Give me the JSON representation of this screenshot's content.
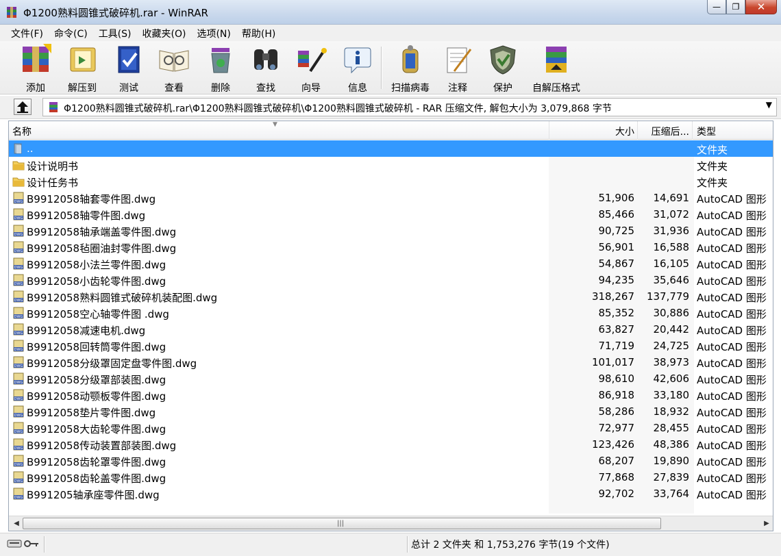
{
  "window": {
    "title": "Φ1200熟料圆锥式破碎机.rar - WinRAR",
    "buttons": {
      "minimize": "—",
      "maximize": "❐",
      "close": "✕"
    }
  },
  "menu": [
    "文件(F)",
    "命令(C)",
    "工具(S)",
    "收藏夹(O)",
    "选项(N)",
    "帮助(H)"
  ],
  "toolbar": {
    "add": "添加",
    "extract": "解压到",
    "test": "测试",
    "view": "查看",
    "delete": "删除",
    "find": "查找",
    "wizard": "向导",
    "info": "信息",
    "scan": "扫描病毒",
    "comment": "注释",
    "protect": "保护",
    "sfx": "自解压格式"
  },
  "address": {
    "path": "Φ1200熟料圆锥式破碎机.rar\\Φ1200熟料圆锥式破碎机\\Φ1200熟料圆锥式破碎机 - RAR 压缩文件, 解包大小为 3,079,868 字节"
  },
  "columns": {
    "name": "名称",
    "size": "大小",
    "packed": "压缩后...",
    "type": "类型"
  },
  "rows": [
    {
      "name": "..",
      "size": "",
      "packed": "",
      "type": "文件夹"
    },
    {
      "name": "设计说明书",
      "size": "",
      "packed": "",
      "type": "文件夹"
    },
    {
      "name": "设计任务书",
      "size": "",
      "packed": "",
      "type": "文件夹"
    },
    {
      "name": "B9912058轴套零件图.dwg",
      "size": "51,906",
      "packed": "14,691",
      "type": "AutoCAD 图形"
    },
    {
      "name": "B9912058轴零件图.dwg",
      "size": "85,466",
      "packed": "31,072",
      "type": "AutoCAD 图形"
    },
    {
      "name": "B9912058轴承端盖零件图.dwg",
      "size": "90,725",
      "packed": "31,936",
      "type": "AutoCAD 图形"
    },
    {
      "name": "B9912058毡圈油封零件图.dwg",
      "size": "56,901",
      "packed": "16,588",
      "type": "AutoCAD 图形"
    },
    {
      "name": "B9912058小法兰零件图.dwg",
      "size": "54,867",
      "packed": "16,105",
      "type": "AutoCAD 图形"
    },
    {
      "name": "B9912058小齿轮零件图.dwg",
      "size": "94,235",
      "packed": "35,646",
      "type": "AutoCAD 图形"
    },
    {
      "name": "B9912058熟料圆锥式破碎机装配图.dwg",
      "size": "318,267",
      "packed": "137,779",
      "type": "AutoCAD 图形"
    },
    {
      "name": "B9912058空心轴零件图 .dwg",
      "size": "85,352",
      "packed": "30,886",
      "type": "AutoCAD 图形"
    },
    {
      "name": "B9912058减速电机.dwg",
      "size": "63,827",
      "packed": "20,442",
      "type": "AutoCAD 图形"
    },
    {
      "name": "B9912058回转筒零件图.dwg",
      "size": "71,719",
      "packed": "24,725",
      "type": "AutoCAD 图形"
    },
    {
      "name": "B9912058分级罩固定盘零件图.dwg",
      "size": "101,017",
      "packed": "38,973",
      "type": "AutoCAD 图形"
    },
    {
      "name": "B9912058分级罩部装图.dwg",
      "size": "98,610",
      "packed": "42,606",
      "type": "AutoCAD 图形"
    },
    {
      "name": "B9912058动颚板零件图.dwg",
      "size": "86,918",
      "packed": "33,180",
      "type": "AutoCAD 图形"
    },
    {
      "name": "B9912058垫片零件图.dwg",
      "size": "58,286",
      "packed": "18,932",
      "type": "AutoCAD 图形"
    },
    {
      "name": "B9912058大齿轮零件图.dwg",
      "size": "72,977",
      "packed": "28,455",
      "type": "AutoCAD 图形"
    },
    {
      "name": "B9912058传动装置部装图.dwg",
      "size": "123,426",
      "packed": "48,386",
      "type": "AutoCAD 图形"
    },
    {
      "name": "B9912058齿轮罩零件图.dwg",
      "size": "68,207",
      "packed": "19,890",
      "type": "AutoCAD 图形"
    },
    {
      "name": "B9912058齿轮盖零件图.dwg",
      "size": "77,868",
      "packed": "27,839",
      "type": "AutoCAD 图形"
    },
    {
      "name": "B991205轴承座零件图.dwg",
      "size": "92,702",
      "packed": "33,764",
      "type": "AutoCAD 图形"
    }
  ],
  "status": {
    "summary": "总计 2 文件夹 和 1,753,276 字节(19 个文件)"
  },
  "colors": {
    "selection": "#3399ff",
    "titlebar": "#c9d8ec"
  }
}
